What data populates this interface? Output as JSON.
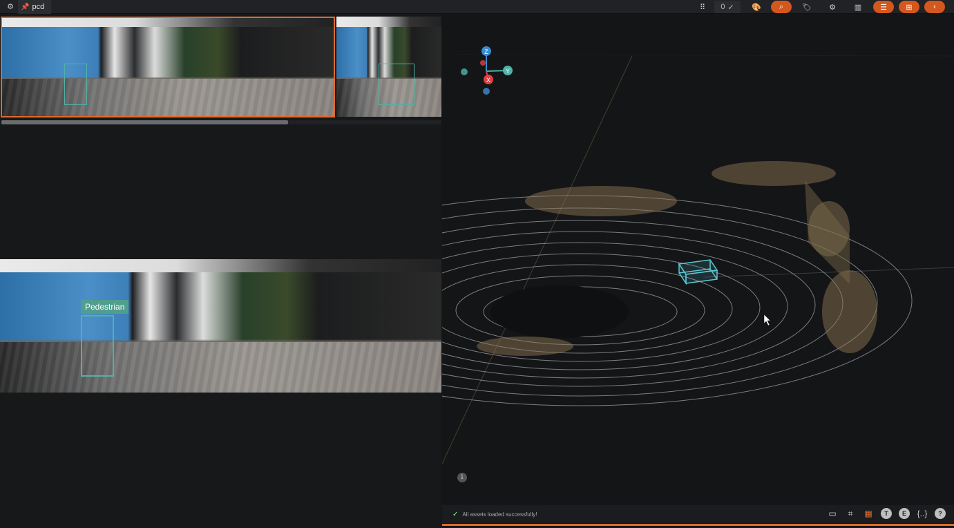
{
  "app": {
    "tab_title": "pcd"
  },
  "toolbar": {
    "counter_value": "0",
    "icons": [
      "grid-dots-icon",
      "check-icon",
      "palette-icon",
      "search-icon",
      "tag-icon",
      "gear-icon",
      "layout-icon",
      "list-icon",
      "compress-icon",
      "chevron-left-icon"
    ]
  },
  "images": {
    "annotation_label": "Pedestrian"
  },
  "viewer": {
    "axes": {
      "z": "Z",
      "y": "Y",
      "x": "X"
    },
    "status_text": "All assets loaded successfully!",
    "bottom_icons": [
      "comment-icon",
      "tree-icon",
      "grid-icon",
      "T",
      "E",
      "{..}",
      "?"
    ]
  },
  "colors": {
    "accent": "#e06a2c",
    "annotation": "#4fb3a8",
    "label_bg": "#4f9e8e"
  }
}
